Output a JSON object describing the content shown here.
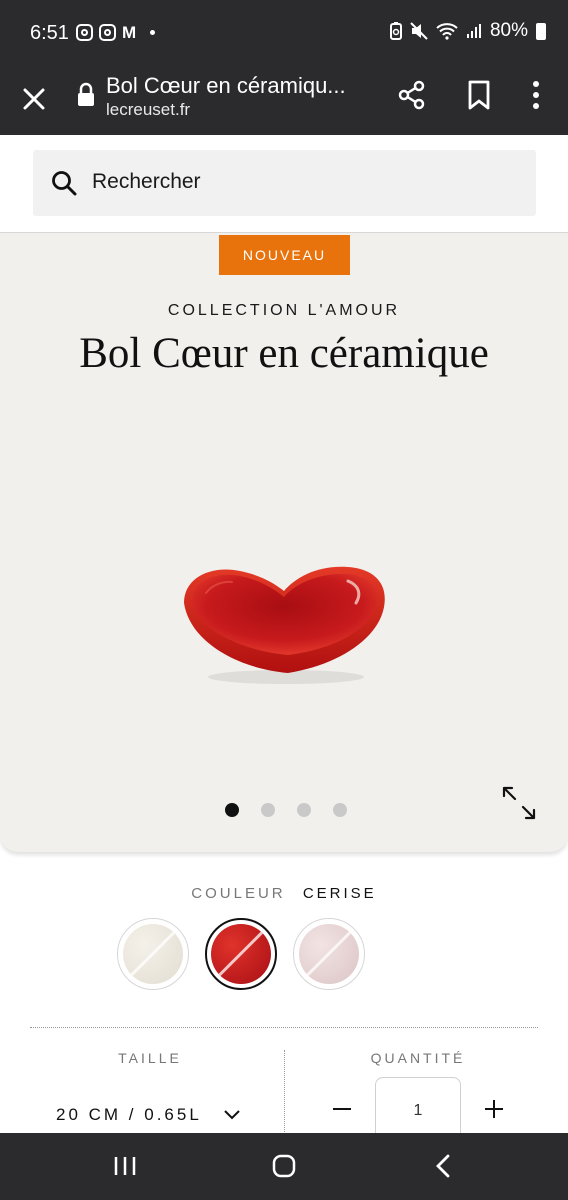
{
  "status_bar": {
    "time": "6:51",
    "battery": "80%",
    "left_icons": [
      "instagram-icon",
      "instagram-icon",
      "gmail-icon",
      "notification-dot"
    ],
    "right_icons": [
      "battery-saver-icon",
      "mute-icon",
      "wifi-icon",
      "signal-icon",
      "battery-icon"
    ]
  },
  "browser": {
    "title": "Bol Cœur en céramiqu...",
    "url": "lecreuset.fr"
  },
  "search": {
    "placeholder": "Rechercher"
  },
  "product": {
    "badge": "NOUVEAU",
    "collection": "COLLECTION L'AMOUR",
    "title": "Bol Cœur en céramique",
    "carousel": {
      "total": 4,
      "active": 1
    },
    "color_label": "COULEUR",
    "color_value": "CERISE",
    "swatches": [
      {
        "name": "meringue",
        "color": "#ebe6dc",
        "selected": false
      },
      {
        "name": "cerise",
        "color": "#c8161d",
        "selected": true
      },
      {
        "name": "shell-pink",
        "color": "#e9d6d6",
        "selected": false
      }
    ],
    "size_label": "TAILLE",
    "size_value": "20 CM / 0.65L",
    "quantity_label": "QUANTITÉ",
    "quantity_value": "1"
  },
  "colors": {
    "badge": "#e8730c",
    "hero_bg": "#f2f0ed",
    "chrome": "#2b2b2d"
  }
}
